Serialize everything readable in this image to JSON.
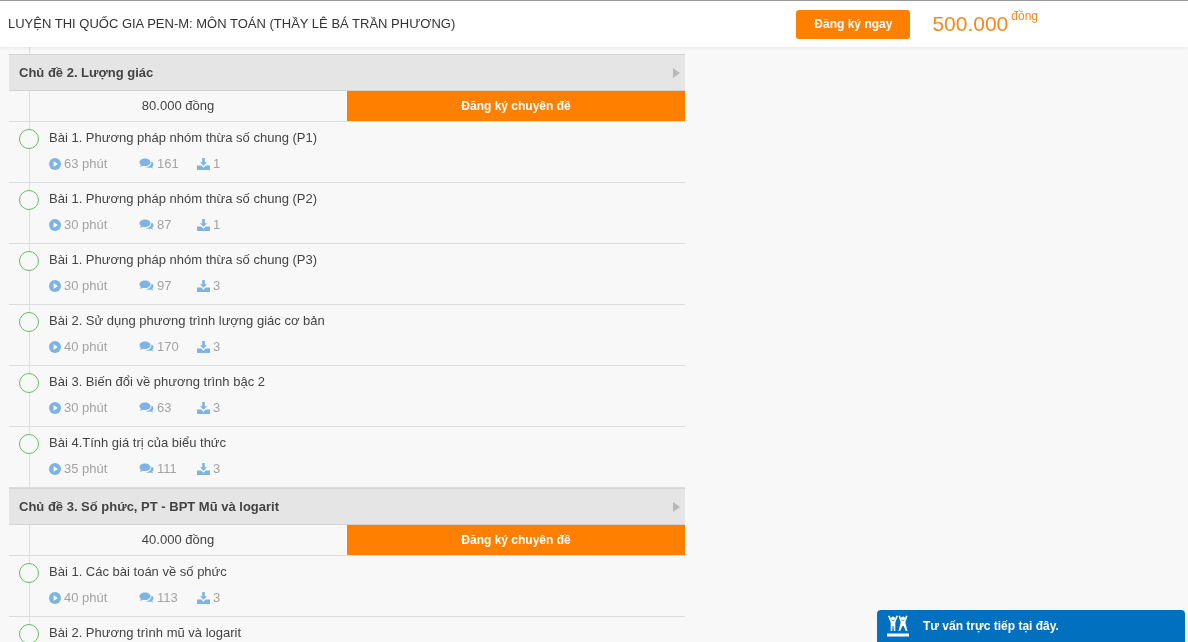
{
  "header": {
    "title": "LUYỆN THI QUỐC GIA PEN-M: MÔN TOÁN (THẦY LÊ BÁ TRẦN PHƯƠNG)",
    "register_button": "Đăng ký ngay",
    "price": "500.000",
    "currency": "đồng"
  },
  "topics": [
    {
      "title": "Chủ đề 2. Lượng giác",
      "price": "80.000 đồng",
      "register_button": "Đăng ký chuyên đề",
      "lessons": [
        {
          "title": "Bài 1. Phương pháp nhóm thừa số chung (P1)",
          "duration": "63 phút",
          "comments": "161",
          "downloads": "1"
        },
        {
          "title": "Bài 1. Phương pháp nhóm thừa số chung (P2)",
          "duration": "30 phút",
          "comments": "87",
          "downloads": "1"
        },
        {
          "title": "Bài 1. Phương pháp nhóm thừa số chung (P3)",
          "duration": "30 phút",
          "comments": "97",
          "downloads": "3"
        },
        {
          "title": "Bài 2. Sử dụng phương trình lượng giác cơ bản",
          "duration": "40 phút",
          "comments": "170",
          "downloads": "3"
        },
        {
          "title": "Bài 3. Biến đổi về phương trình bậc 2",
          "duration": "30 phút",
          "comments": "63",
          "downloads": "3"
        },
        {
          "title": "Bài 4.Tính giá trị của biểu thức",
          "duration": "35 phút",
          "comments": "111",
          "downloads": "3"
        }
      ]
    },
    {
      "title": "Chủ đề 3. Số phức, PT - BPT Mũ và logarit",
      "price": "40.000 đồng",
      "register_button": "Đăng ký chuyên đề",
      "lessons": [
        {
          "title": "Bài 1. Các bài toán về số phức",
          "duration": "40 phút",
          "comments": "113",
          "downloads": "3"
        },
        {
          "title": "Bài 2. Phương trình mũ và logarit"
        }
      ]
    }
  ],
  "chat_widget": {
    "label": "Tư vấn trực tiếp tại đây."
  }
}
